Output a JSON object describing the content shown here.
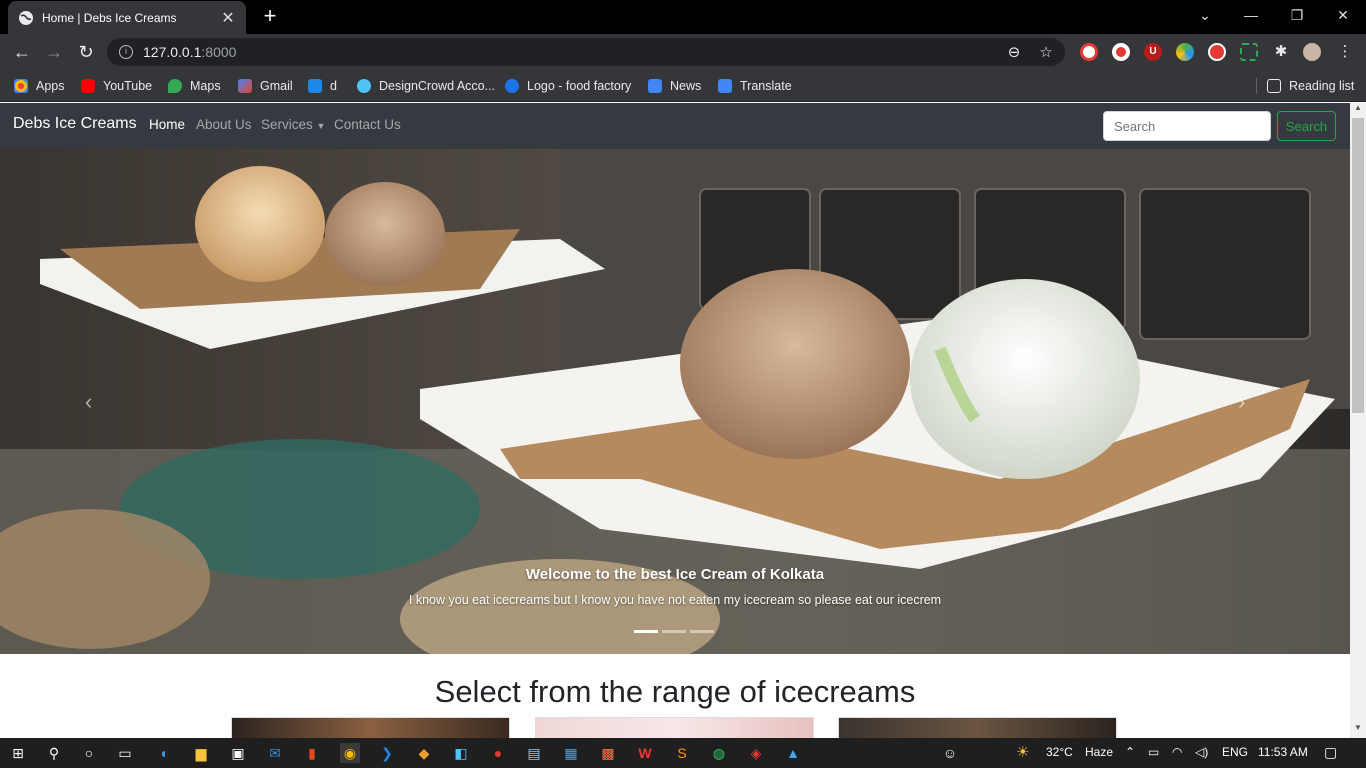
{
  "browser": {
    "tab_title": "Home | Debs Ice Creams",
    "url_host": "127.0.0.1",
    "url_port": ":8000",
    "bookmarks": [
      {
        "label": "Apps",
        "color": "#ea4335"
      },
      {
        "label": "YouTube",
        "color": "#ff0000"
      },
      {
        "label": "Maps",
        "color": "#34a853"
      },
      {
        "label": "Gmail",
        "color": "#ea4335"
      },
      {
        "label": "d",
        "color": "#1e88e5"
      },
      {
        "label": "DesignCrowd Acco...",
        "color": "#4fc3f7"
      },
      {
        "label": "Logo - food factory",
        "color": "#1a73e8"
      },
      {
        "label": "News",
        "color": "#4285f4"
      },
      {
        "label": "Translate",
        "color": "#4285f4"
      }
    ],
    "reading_list": "Reading list"
  },
  "site": {
    "brand": "Debs Ice Creams",
    "nav": {
      "home": "Home",
      "about": "About Us",
      "services": "Services",
      "contact": "Contact Us"
    },
    "search_placeholder": "Search",
    "search_button": "Search",
    "carousel": {
      "caption_title": "Welcome to the best Ice Cream of Kolkata",
      "caption_text": "I know you eat icecreams but I know you have not eaten my icecream so please eat our icecrem",
      "active_index": 0,
      "slide_count": 3
    },
    "section_title": "Select from the range of icecreams"
  },
  "taskbar": {
    "weather_temp": "32°C",
    "weather_desc": "Haze",
    "lang": "ENG",
    "time": "11:53 AM"
  },
  "colors": {
    "navbar": "#343a40",
    "accent_green": "#28a745"
  }
}
